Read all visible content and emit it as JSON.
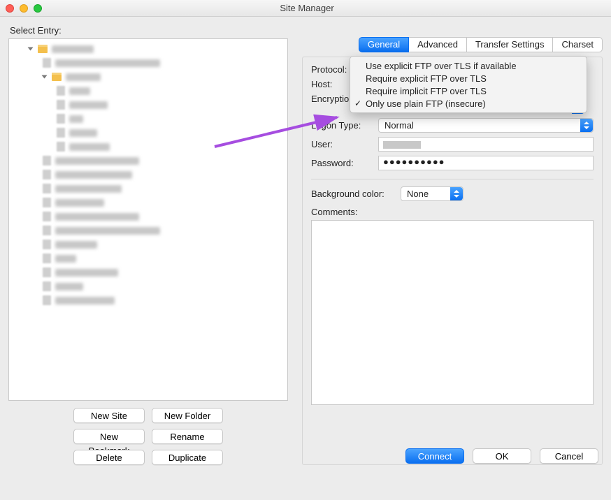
{
  "window": {
    "title": "Site Manager"
  },
  "left": {
    "label": "Select Entry:",
    "buttons": {
      "new_site": "New Site",
      "new_folder": "New Folder",
      "new_bookmark": "New Bookmark",
      "rename": "Rename",
      "delete": "Delete",
      "duplicate": "Duplicate"
    }
  },
  "tabs": {
    "general": "General",
    "advanced": "Advanced",
    "transfer_settings": "Transfer Settings",
    "charset": "Charset",
    "active": "general"
  },
  "form": {
    "labels": {
      "protocol": "Protocol:",
      "host": "Host:",
      "encryption": "Encryption:",
      "logon_type": "Logon Type:",
      "user": "User:",
      "password": "Password:",
      "background_color": "Background color:",
      "comments": "Comments:"
    },
    "values": {
      "logon_type": "Normal",
      "background_color": "None",
      "password_mask": "●●●●●●●●●●"
    }
  },
  "encryption_menu": {
    "options": [
      "Use explicit FTP over TLS if available",
      "Require explicit FTP over TLS",
      "Require implicit FTP over TLS",
      "Only use plain FTP (insecure)"
    ],
    "selected_index": 3
  },
  "bottom": {
    "connect": "Connect",
    "ok": "OK",
    "cancel": "Cancel"
  }
}
